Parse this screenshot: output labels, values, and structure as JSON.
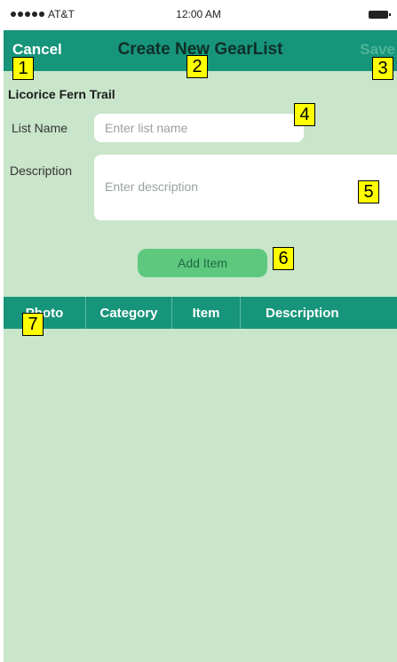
{
  "status_bar": {
    "carrier": "AT&T",
    "time": "12:00 AM"
  },
  "nav": {
    "cancel_label": "Cancel",
    "title": "Create New GearList",
    "save_label": "Save"
  },
  "form": {
    "trail_name": "Licorice Fern Trail",
    "list_name_label": "List Name",
    "list_name_placeholder": "Enter list name",
    "description_label": "Description",
    "description_placeholder": "Enter description",
    "add_item_label": "Add Item"
  },
  "table": {
    "columns": [
      "Photo",
      "Category",
      "Item",
      "Description"
    ]
  },
  "annotations": [
    "1",
    "2",
    "3",
    "4",
    "5",
    "6",
    "7"
  ],
  "colors": {
    "nav_bg": "#17957b",
    "screen_bg": "#c9e5ca",
    "button_bg": "#5ec87e",
    "badge_bg": "#ffff00"
  }
}
